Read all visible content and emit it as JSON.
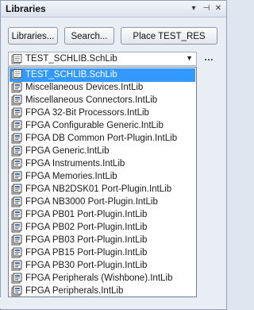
{
  "panel": {
    "title": "Libraries",
    "pin_glyph": "⊣",
    "close_glyph": "✕",
    "menu_glyph": "▾"
  },
  "toolbar": {
    "libraries_label": "Libraries...",
    "search_label": "Search...",
    "place_label": "Place TEST_RES"
  },
  "combo": {
    "value": "TEST_SCHLIB.SchLib",
    "more_label": "…"
  },
  "libraries": [
    {
      "label": "TEST_SCHLIB.SchLib",
      "icon": "schlib-icon",
      "selected": true
    },
    {
      "label": "Miscellaneous Devices.IntLib",
      "icon": "intlib-icon"
    },
    {
      "label": "Miscellaneous Connectors.IntLib",
      "icon": "intlib-icon"
    },
    {
      "label": "FPGA 32-Bit Processors.IntLib",
      "icon": "intlib-icon"
    },
    {
      "label": "FPGA Configurable Generic.IntLib",
      "icon": "intlib-icon"
    },
    {
      "label": "FPGA DB Common Port-Plugin.IntLib",
      "icon": "intlib-icon"
    },
    {
      "label": "FPGA Generic.IntLib",
      "icon": "intlib-icon"
    },
    {
      "label": "FPGA Instruments.IntLib",
      "icon": "intlib-icon"
    },
    {
      "label": "FPGA Memories.IntLib",
      "icon": "intlib-icon"
    },
    {
      "label": "FPGA NB2DSK01 Port-Plugin.IntLib",
      "icon": "intlib-icon"
    },
    {
      "label": "FPGA NB3000 Port-Plugin.IntLib",
      "icon": "intlib-icon"
    },
    {
      "label": "FPGA PB01 Port-Plugin.IntLib",
      "icon": "intlib-icon"
    },
    {
      "label": "FPGA PB02 Port-Plugin.IntLib",
      "icon": "intlib-icon"
    },
    {
      "label": "FPGA PB03 Port-Plugin.IntLib",
      "icon": "intlib-icon"
    },
    {
      "label": "FPGA PB15 Port-Plugin.IntLib",
      "icon": "intlib-icon"
    },
    {
      "label": "FPGA PB30 Port-Plugin.IntLib",
      "icon": "intlib-icon"
    },
    {
      "label": "FPGA Peripherals (Wishbone).IntLib",
      "icon": "intlib-icon"
    },
    {
      "label": "FPGA Peripherals.IntLib",
      "icon": "intlib-icon"
    }
  ]
}
